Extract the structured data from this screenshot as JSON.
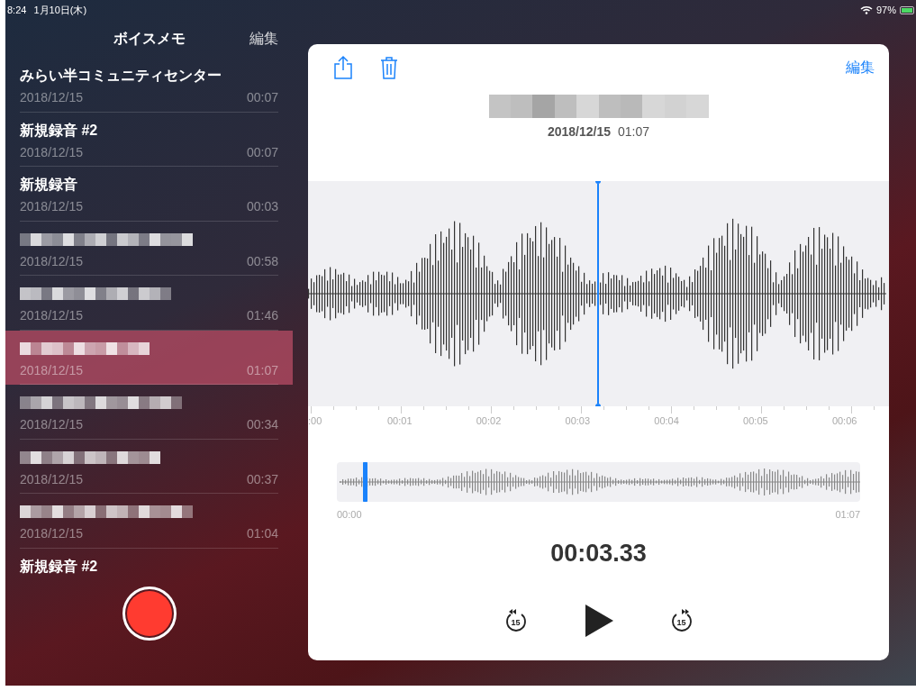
{
  "status_bar": {
    "time": "8:24",
    "date": "1月10日(木)",
    "battery": "97%",
    "charging": true
  },
  "sidebar": {
    "title": "ボイスメモ",
    "edit": "編集",
    "recordings": [
      {
        "kind": "text",
        "title": "みらい半コミュニティセンター",
        "date": "2018/12/15",
        "duration": "00:07",
        "selected": false
      },
      {
        "kind": "text",
        "title": "新規録音 #2",
        "date": "2018/12/15",
        "duration": "00:07",
        "selected": false
      },
      {
        "kind": "text",
        "title": "新規録音",
        "date": "2018/12/15",
        "duration": "00:03",
        "selected": false
      },
      {
        "kind": "redacted",
        "date": "2018/12/15",
        "duration": "00:58",
        "selected": false
      },
      {
        "kind": "redacted",
        "date": "2018/12/15",
        "duration": "01:46",
        "selected": false
      },
      {
        "kind": "redacted",
        "date": "2018/12/15",
        "duration": "01:07",
        "selected": true
      },
      {
        "kind": "redacted",
        "date": "2018/12/15",
        "duration": "00:34",
        "selected": false
      },
      {
        "kind": "redacted",
        "date": "2018/12/15",
        "duration": "00:37",
        "selected": false
      },
      {
        "kind": "redacted",
        "date": "2018/12/15",
        "duration": "01:04",
        "selected": false
      },
      {
        "kind": "text",
        "title": "新規録音 #2",
        "selected": false
      }
    ]
  },
  "detail": {
    "edit": "編集",
    "title": {
      "kind": "redacted"
    },
    "date": "2018/12/15",
    "duration": "01:07",
    "timeline_ticks": [
      ":00",
      "00:01",
      "00:02",
      "00:03",
      "00:04",
      "00:05",
      "00:06"
    ],
    "overview": {
      "start": "00:00",
      "end": "01:07",
      "level": 0.05
    },
    "current_time": "00:03.33",
    "playing": false,
    "skip_back": "15",
    "skip_forward": "15"
  }
}
